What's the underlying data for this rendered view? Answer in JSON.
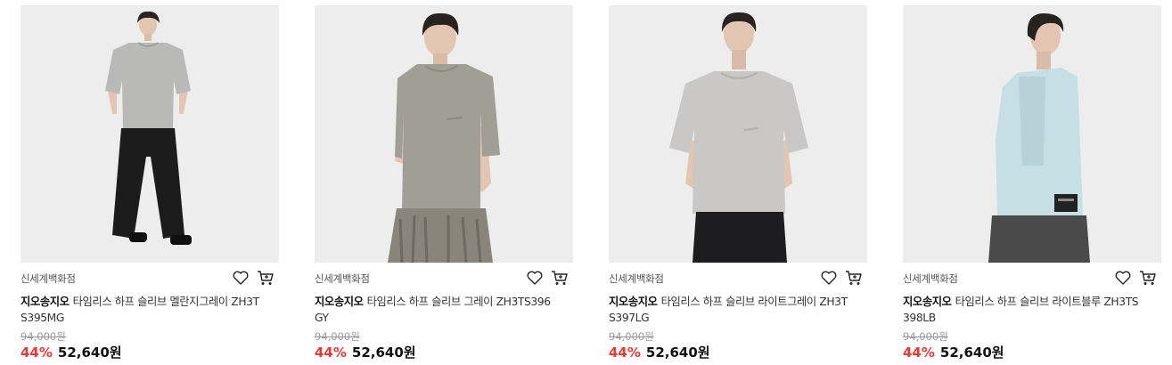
{
  "products": [
    {
      "seller": "신세계백화점",
      "brand": "지오송지오",
      "name": "타임리스 하프 슬리브 멜란지그레이 ZH3TS395MG",
      "original_price": "94,000원",
      "discount": "44%",
      "price": "52,640원",
      "image": "model-light-grey-tee-black-pants",
      "shirt_color": "#b9b9b7",
      "pants_color": "#1c1c1c"
    },
    {
      "seller": "신세계백화점",
      "brand": "지오송지오",
      "name": "타임리스 하프 슬리브 그레이 ZH3TS396GY",
      "original_price": "94,000원",
      "discount": "44%",
      "price": "52,640원",
      "image": "model-grey-tee-camo-pants",
      "shirt_color": "#a19e96",
      "pants_color": "#8a857b"
    },
    {
      "seller": "신세계백화점",
      "brand": "지오송지오",
      "name": "타임리스 하프 슬리브 라이트그레이 ZH3TS397LG",
      "original_price": "94,000원",
      "discount": "44%",
      "price": "52,640원",
      "image": "model-light-grey-tee-front",
      "shirt_color": "#c9c8c6",
      "pants_color": "#1d1d1f"
    },
    {
      "seller": "신세계백화점",
      "brand": "지오송지오",
      "name": "타임리스 하프 슬리브 라이트블루 ZH3TS398LB",
      "original_price": "94,000원",
      "discount": "44%",
      "price": "52,640원",
      "image": "model-light-blue-tee-side",
      "shirt_color": "#c6dfe4",
      "pants_color": "#4a4a4a"
    }
  ],
  "icons": {
    "wishlist": "heart-icon",
    "cart": "cart-icon"
  },
  "colors": {
    "discount": "#e53935",
    "image_background": "#ededed",
    "skin": "#e2c6b2",
    "hair": "#2a221e"
  }
}
